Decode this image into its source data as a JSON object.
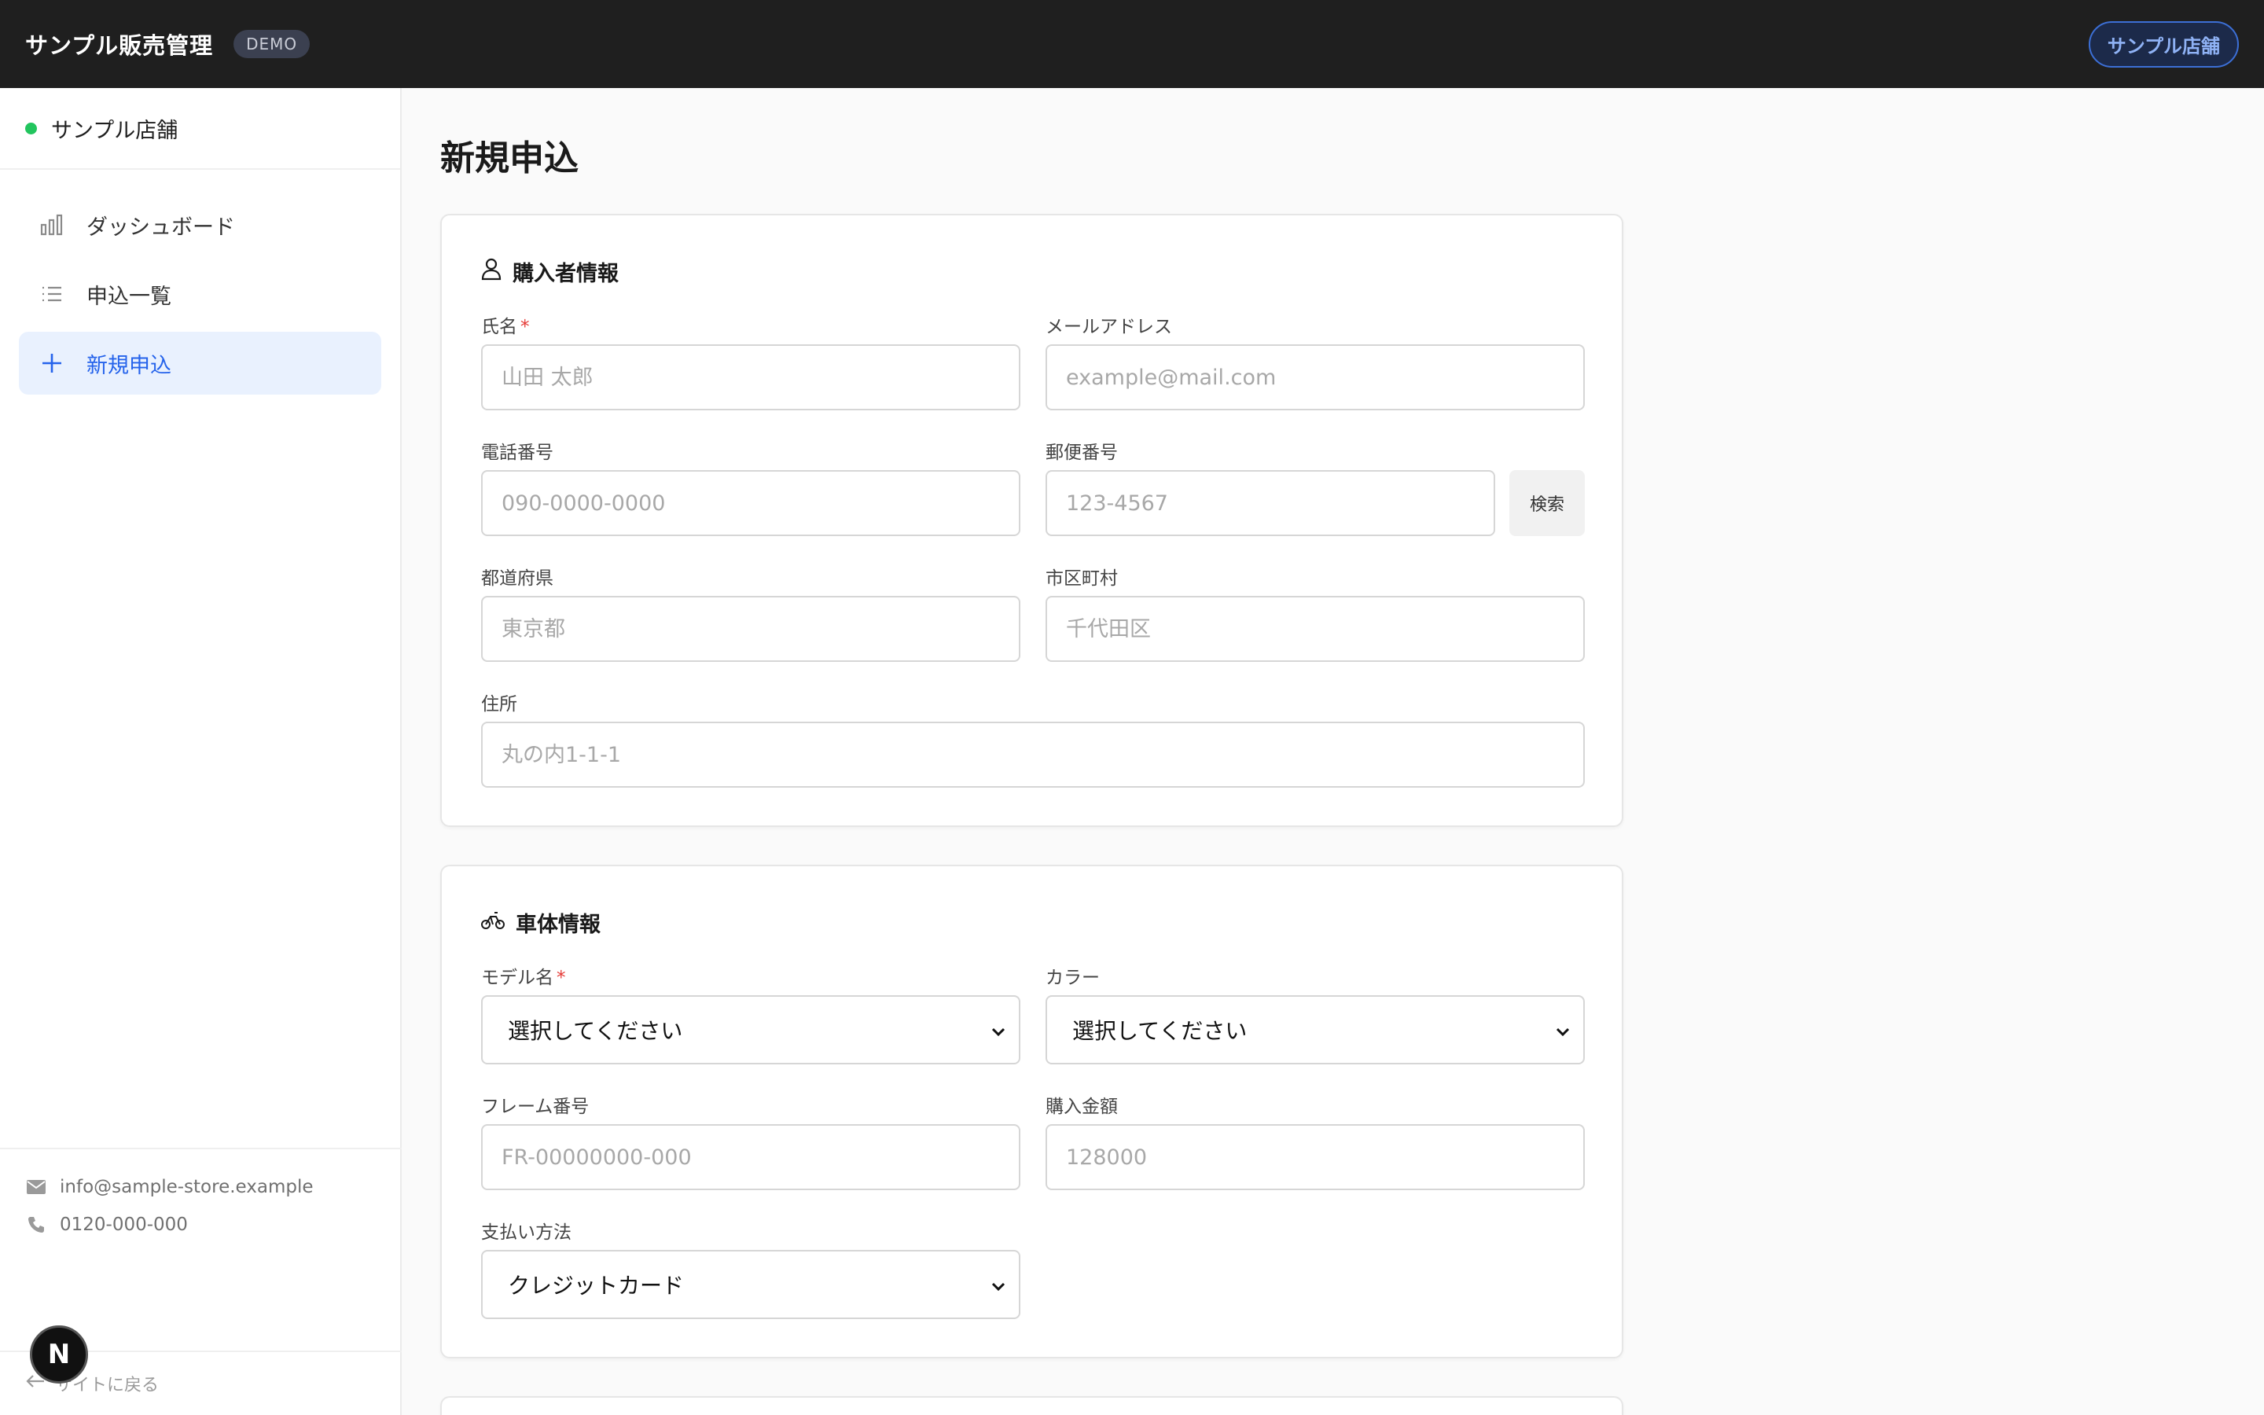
{
  "header": {
    "title": "サンプル販売管理",
    "badge": "DEMO",
    "store_button": "サンプル店舗"
  },
  "sidebar": {
    "store_name": "サンプル店舗",
    "status_color": "#22c55e",
    "items": [
      {
        "label": "ダッシュボード",
        "icon": "bar-chart-icon",
        "active": false
      },
      {
        "label": "申込一覧",
        "icon": "list-icon",
        "active": false
      },
      {
        "label": "新規申込",
        "icon": "plus-icon",
        "active": true
      }
    ],
    "email": "info@sample-store.example",
    "phone": "0120-000-000",
    "back_label": "サイトに戻る"
  },
  "page": {
    "title": "新規申込"
  },
  "buyer": {
    "heading": "購入者情報",
    "name_label": "氏名",
    "name_placeholder": "山田 太郎",
    "required_mark": "*",
    "email_label": "メールアドレス",
    "email_placeholder": "example@mail.com",
    "phone_label": "電話番号",
    "phone_placeholder": "090-0000-0000",
    "zip_label": "郵便番号",
    "zip_placeholder": "123-4567",
    "search_button": "検索",
    "pref_label": "都道府県",
    "pref_placeholder": "東京都",
    "city_label": "市区町村",
    "city_placeholder": "千代田区",
    "address_label": "住所",
    "address_placeholder": "丸の内1-1-1"
  },
  "vehicle": {
    "heading": "車体情報",
    "model_label": "モデル名",
    "model_value": "選択してください",
    "color_label": "カラー",
    "color_value": "選択してください",
    "frame_label": "フレーム番号",
    "frame_placeholder": "FR-00000000-000",
    "price_label": "購入金額",
    "price_placeholder": "128000",
    "payment_label": "支払い方法",
    "payment_value": "クレジットカード"
  },
  "floating_badge": "N",
  "colors": {
    "accent": "#2563eb",
    "header_bg": "#1f1f1f",
    "required": "#e53935"
  }
}
